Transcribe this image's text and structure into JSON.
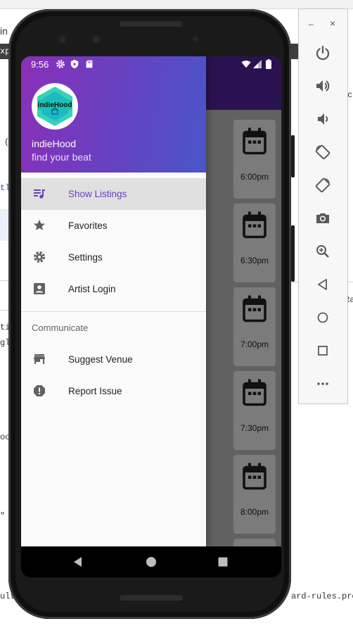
{
  "ide": {
    "fragments": [
      "in",
      "xp",
      "cl",
      "(",
      "tl",
      "ti",
      "gle",
      "Ra",
      "oo",
      "\"",
      "ult",
      "ard-rules.pro"
    ]
  },
  "status_bar": {
    "time": "9:56",
    "icons": [
      "gear-icon",
      "shield-play-icon",
      "sd-card-icon",
      "wifi-icon",
      "signal-icon",
      "battery-icon"
    ]
  },
  "drawer": {
    "app_name": "indieHood",
    "tagline": "find your beat",
    "logo_text": "indieHood",
    "items": [
      {
        "label": "Show Listings",
        "icon": "queue-music-icon",
        "active": true
      },
      {
        "label": "Favorites",
        "icon": "star-icon",
        "active": false
      },
      {
        "label": "Settings",
        "icon": "gear-icon",
        "active": false
      },
      {
        "label": "Artist Login",
        "icon": "account-box-icon",
        "active": false
      }
    ],
    "section_label": "Communicate",
    "section_items": [
      {
        "label": "Suggest Venue",
        "icon": "store-icon"
      },
      {
        "label": "Report Issue",
        "icon": "alert-icon"
      }
    ]
  },
  "listings": [
    {
      "time": "6:00pm",
      "icon": "calendar-icon"
    },
    {
      "time": "6:30pm",
      "icon": "calendar-icon"
    },
    {
      "time": "7:00pm",
      "icon": "calendar-icon"
    },
    {
      "time": "7:30pm",
      "icon": "calendar-icon"
    },
    {
      "time": "8:00pm",
      "icon": "calendar-icon"
    }
  ],
  "emulator_panel": {
    "minimize": "–",
    "close": "×",
    "buttons": [
      "power-icon",
      "volume-up-icon",
      "volume-down-icon",
      "rotate-left-icon",
      "rotate-right-icon",
      "camera-icon",
      "zoom-icon",
      "back-icon",
      "home-icon",
      "overview-icon",
      "more-icon"
    ]
  },
  "colors": {
    "accent": "#6a3fc0",
    "header_start": "#8a2fb7",
    "header_end": "#4a55c9",
    "app_bar": "#2a1250"
  }
}
